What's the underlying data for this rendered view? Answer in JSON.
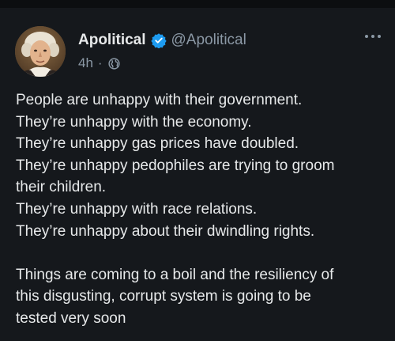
{
  "post": {
    "author": {
      "display_name": "Apolitical",
      "handle": "@Apolitical",
      "verified": true,
      "avatar_icon": "portrait-avatar"
    },
    "meta": {
      "time": "4h",
      "separator": "·",
      "visibility_icon": "globe-icon"
    },
    "more_icon": "more-options-icon",
    "lines": [
      "People are unhappy with their government.",
      "They’re unhappy with the economy.",
      "They’re unhappy gas prices have doubled.",
      "They’re unhappy pedophiles are trying to groom",
      "their children.",
      "They’re unhappy with race relations.",
      "They’re unhappy about their dwindling rights."
    ],
    "lines2": [
      "Things are coming to a boil and the resiliency of",
      "this disgusting, corrupt system is going to be",
      "tested very soon"
    ]
  },
  "colors": {
    "background": "#15181c",
    "text": "#e7e9ea",
    "secondary": "#8b98a5",
    "verified": "#1d9bf0"
  }
}
